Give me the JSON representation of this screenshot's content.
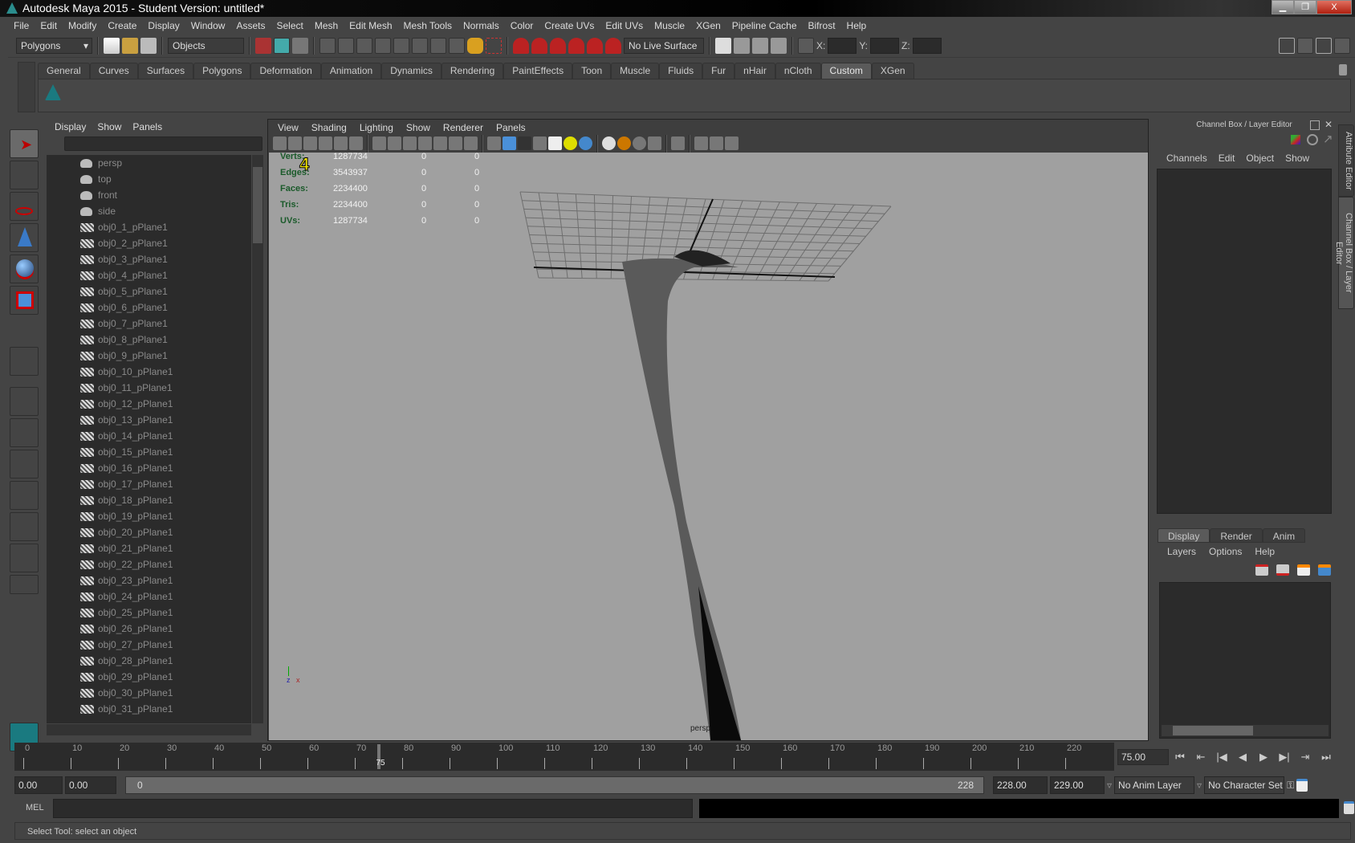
{
  "window": {
    "title": "Autodesk Maya 2015 - Student Version: untitled*",
    "minimize": "▁",
    "restore": "❐",
    "close": "X"
  },
  "menubar": [
    "File",
    "Edit",
    "Modify",
    "Create",
    "Display",
    "Window",
    "Assets",
    "Select",
    "Mesh",
    "Edit Mesh",
    "Mesh Tools",
    "Normals",
    "Color",
    "Create UVs",
    "Edit UVs",
    "Muscle",
    "XGen",
    "Pipeline Cache",
    "Bifrost",
    "Help"
  ],
  "statusline": {
    "mode": "Polygons",
    "selection_mode": "Objects",
    "live_surface": "No Live Surface",
    "x_label": "X:",
    "y_label": "Y:",
    "z_label": "Z:",
    "x": "",
    "y": "",
    "z": ""
  },
  "shelf": {
    "tabs": [
      "General",
      "Curves",
      "Surfaces",
      "Polygons",
      "Deformation",
      "Animation",
      "Dynamics",
      "Rendering",
      "PaintEffects",
      "Toon",
      "Muscle",
      "Fluids",
      "Fur",
      "nHair",
      "nCloth",
      "Custom",
      "XGen"
    ],
    "active": "Custom"
  },
  "outliner": {
    "menu": [
      "Display",
      "Show",
      "Panels"
    ],
    "filter": "",
    "items": [
      {
        "name": "persp",
        "type": "camera"
      },
      {
        "name": "top",
        "type": "camera"
      },
      {
        "name": "front",
        "type": "camera"
      },
      {
        "name": "side",
        "type": "camera"
      },
      {
        "name": "obj0_1_pPlane1",
        "type": "mesh"
      },
      {
        "name": "obj0_2_pPlane1",
        "type": "mesh"
      },
      {
        "name": "obj0_3_pPlane1",
        "type": "mesh"
      },
      {
        "name": "obj0_4_pPlane1",
        "type": "mesh"
      },
      {
        "name": "obj0_5_pPlane1",
        "type": "mesh"
      },
      {
        "name": "obj0_6_pPlane1",
        "type": "mesh"
      },
      {
        "name": "obj0_7_pPlane1",
        "type": "mesh"
      },
      {
        "name": "obj0_8_pPlane1",
        "type": "mesh"
      },
      {
        "name": "obj0_9_pPlane1",
        "type": "mesh"
      },
      {
        "name": "obj0_10_pPlane1",
        "type": "mesh"
      },
      {
        "name": "obj0_11_pPlane1",
        "type": "mesh"
      },
      {
        "name": "obj0_12_pPlane1",
        "type": "mesh"
      },
      {
        "name": "obj0_13_pPlane1",
        "type": "mesh"
      },
      {
        "name": "obj0_14_pPlane1",
        "type": "mesh"
      },
      {
        "name": "obj0_15_pPlane1",
        "type": "mesh"
      },
      {
        "name": "obj0_16_pPlane1",
        "type": "mesh"
      },
      {
        "name": "obj0_17_pPlane1",
        "type": "mesh"
      },
      {
        "name": "obj0_18_pPlane1",
        "type": "mesh"
      },
      {
        "name": "obj0_19_pPlane1",
        "type": "mesh"
      },
      {
        "name": "obj0_20_pPlane1",
        "type": "mesh"
      },
      {
        "name": "obj0_21_pPlane1",
        "type": "mesh"
      },
      {
        "name": "obj0_22_pPlane1",
        "type": "mesh"
      },
      {
        "name": "obj0_23_pPlane1",
        "type": "mesh"
      },
      {
        "name": "obj0_24_pPlane1",
        "type": "mesh"
      },
      {
        "name": "obj0_25_pPlane1",
        "type": "mesh"
      },
      {
        "name": "obj0_26_pPlane1",
        "type": "mesh"
      },
      {
        "name": "obj0_27_pPlane1",
        "type": "mesh"
      },
      {
        "name": "obj0_28_pPlane1",
        "type": "mesh"
      },
      {
        "name": "obj0_29_pPlane1",
        "type": "mesh"
      },
      {
        "name": "obj0_30_pPlane1",
        "type": "mesh"
      },
      {
        "name": "obj0_31_pPlane1",
        "type": "mesh"
      }
    ]
  },
  "viewport": {
    "menu": [
      "View",
      "Shading",
      "Lighting",
      "Show",
      "Renderer",
      "Panels"
    ],
    "hud": [
      {
        "label": "Verts:",
        "values": [
          "1287734",
          "0",
          "0"
        ]
      },
      {
        "label": "Edges:",
        "values": [
          "3543937",
          "0",
          "0"
        ]
      },
      {
        "label": "Faces:",
        "values": [
          "2234400",
          "0",
          "0"
        ]
      },
      {
        "label": "Tris:",
        "values": [
          "2234400",
          "0",
          "0"
        ]
      },
      {
        "label": "UVs:",
        "values": [
          "1287734",
          "0",
          "0"
        ]
      }
    ],
    "camera_label": "persp",
    "axis_z": "z",
    "axis_x": "x",
    "annotation": "4",
    "annotation_color": "#f5e800"
  },
  "channelbox": {
    "title": "Channel Box / Layer Editor",
    "menu": [
      "Channels",
      "Edit",
      "Object",
      "Show"
    ]
  },
  "layereditor": {
    "tabs": [
      "Display",
      "Render",
      "Anim"
    ],
    "active": "Display",
    "menu": [
      "Layers",
      "Options",
      "Help"
    ]
  },
  "side_tabs": [
    "Attribute Editor",
    "Channel Box / Layer Editor"
  ],
  "timeline": {
    "start": 0,
    "end": 228,
    "tick_labels": [
      0,
      10,
      20,
      30,
      40,
      50,
      60,
      70,
      80,
      90,
      100,
      110,
      120,
      130,
      140,
      150,
      160,
      170,
      180,
      190,
      200,
      210,
      220
    ],
    "current_frame": 75,
    "current_frame_label": "75",
    "current_field": "75.00",
    "playback": [
      "⏮",
      "⇤",
      "|◀",
      "◀",
      "▶",
      "▶|",
      "⇥",
      "⏭"
    ]
  },
  "range": {
    "start_time": "0.00",
    "playback_start": "0.00",
    "slider_start": "0",
    "slider_end": "228",
    "playback_end": "228.00",
    "end_time": "229.00",
    "anim_layer": "No Anim Layer",
    "character_set": "No Character Set"
  },
  "commandline": {
    "label": "MEL",
    "input": "",
    "output": ""
  },
  "helpline": "Select Tool: select an object",
  "colors": {
    "background": "#444444",
    "viewport": "#a0a0a0",
    "hud_label": "#1a5a2a"
  }
}
